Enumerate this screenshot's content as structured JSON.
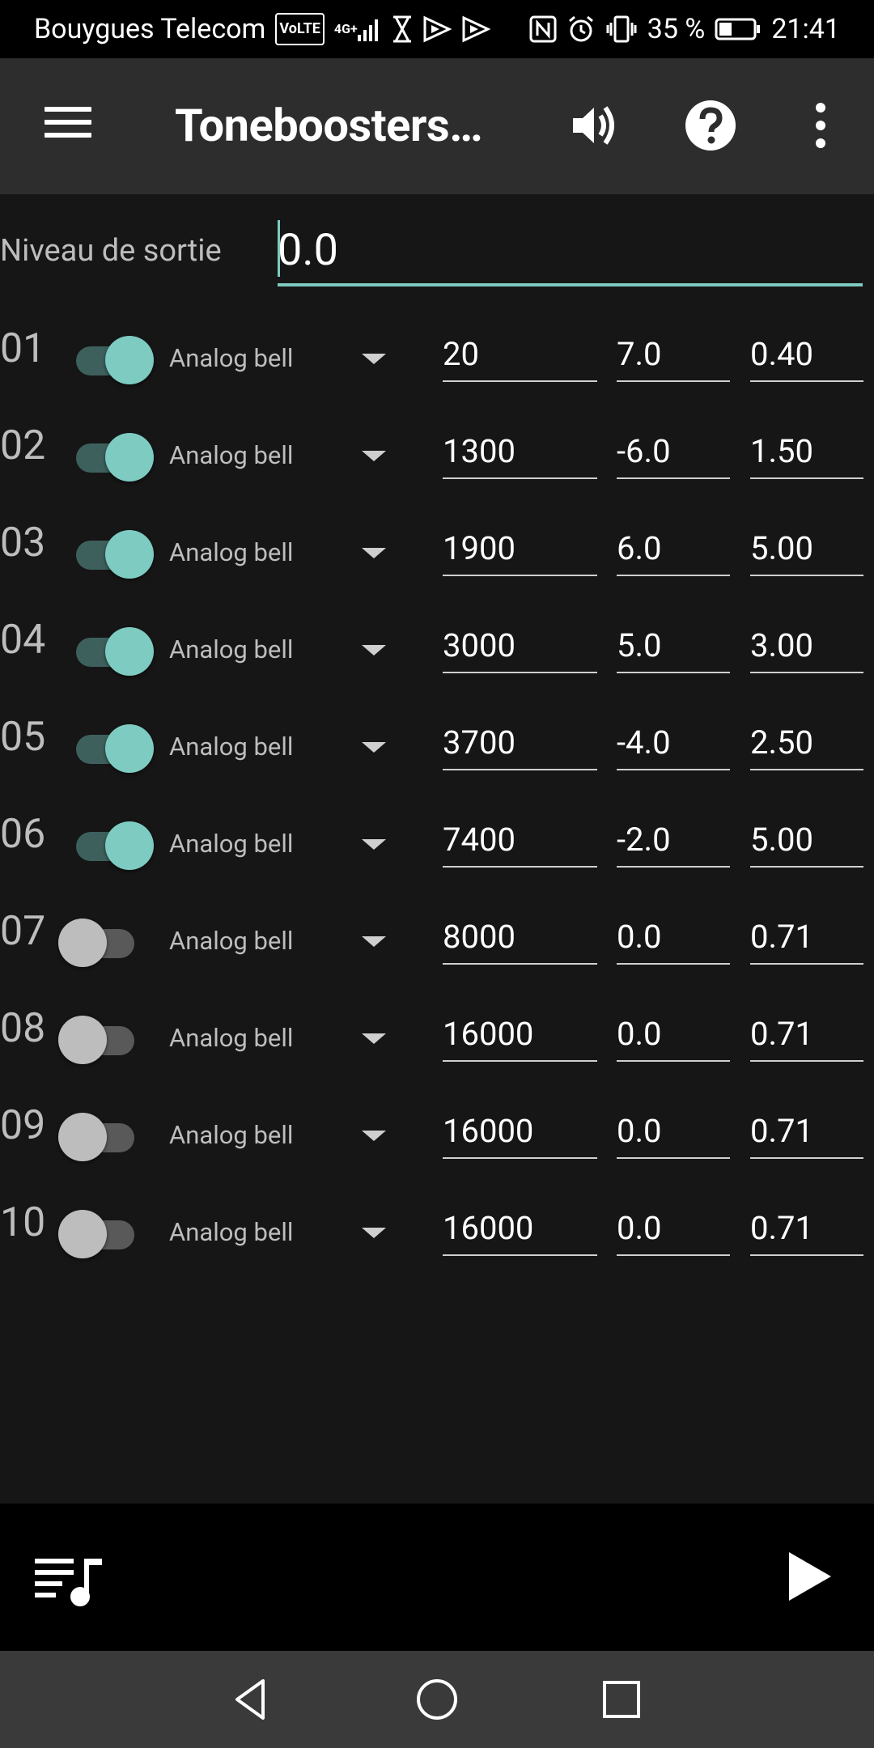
{
  "status_bar": {
    "carrier": "Bouygues Telecom",
    "volte": "VoLTE",
    "network": "4G+",
    "battery": "35 %",
    "time": "21:41",
    "icons": [
      "volte-icon",
      "signal-icon",
      "hourglass-icon",
      "media-icon",
      "nfc-icon",
      "alarm-icon",
      "vibrate-icon",
      "battery-icon"
    ]
  },
  "app_bar": {
    "title": "Toneboosters…",
    "icons": [
      "menu-icon",
      "volume-icon",
      "help-icon",
      "more-vert-icon"
    ]
  },
  "output_level": {
    "label": "Niveau de sortie",
    "value": "0.0"
  },
  "bands": [
    {
      "num": "01",
      "enabled": true,
      "type": "Analog bell",
      "freq": "20",
      "gain": "7.0",
      "q": "0.40"
    },
    {
      "num": "02",
      "enabled": true,
      "type": "Analog bell",
      "freq": "1300",
      "gain": "-6.0",
      "q": "1.50"
    },
    {
      "num": "03",
      "enabled": true,
      "type": "Analog bell",
      "freq": "1900",
      "gain": "6.0",
      "q": "5.00"
    },
    {
      "num": "04",
      "enabled": true,
      "type": "Analog bell",
      "freq": "3000",
      "gain": "5.0",
      "q": "3.00"
    },
    {
      "num": "05",
      "enabled": true,
      "type": "Analog bell",
      "freq": "3700",
      "gain": "-4.0",
      "q": "2.50"
    },
    {
      "num": "06",
      "enabled": true,
      "type": "Analog bell",
      "freq": "7400",
      "gain": "-2.0",
      "q": "5.00"
    },
    {
      "num": "07",
      "enabled": false,
      "type": "Analog bell",
      "freq": "8000",
      "gain": "0.0",
      "q": "0.71"
    },
    {
      "num": "08",
      "enabled": false,
      "type": "Analog bell",
      "freq": "16000",
      "gain": "0.0",
      "q": "0.71"
    },
    {
      "num": "09",
      "enabled": false,
      "type": "Analog bell",
      "freq": "16000",
      "gain": "0.0",
      "q": "0.71"
    },
    {
      "num": "10",
      "enabled": false,
      "type": "Analog bell",
      "freq": "16000",
      "gain": "0.0",
      "q": "0.71"
    }
  ],
  "player": {
    "icons": [
      "queue-music-icon",
      "play-icon"
    ]
  },
  "nav_bar": {
    "icons": [
      "back-icon",
      "home-icon",
      "recents-icon"
    ]
  },
  "colors": {
    "accent": "#7dcbc1",
    "accent_track": "#3e605d",
    "app_bar": "#2d2d2d",
    "background": "#161616",
    "nav_bar": "#3a3a3a"
  }
}
